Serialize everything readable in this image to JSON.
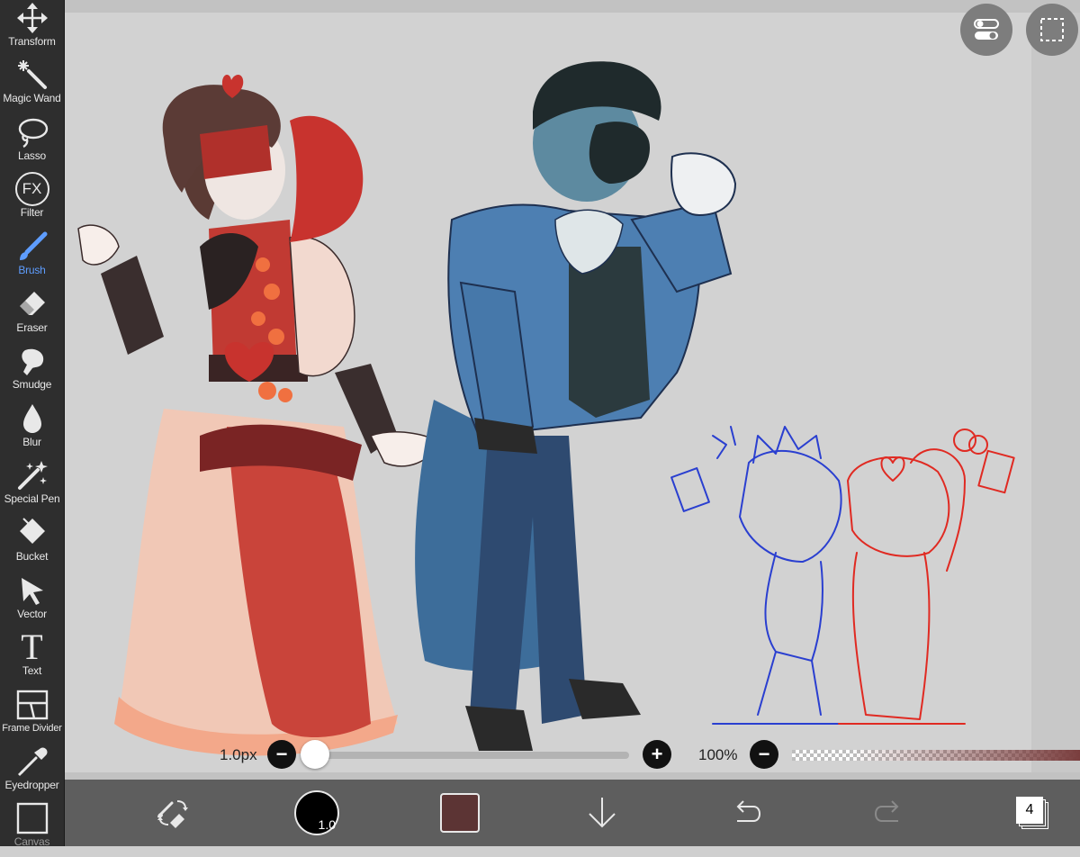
{
  "toolbar": {
    "tools": [
      {
        "label": "Transform"
      },
      {
        "label": "Magic Wand"
      },
      {
        "label": "Lasso"
      },
      {
        "label": "Filter",
        "icon_text": "FX"
      },
      {
        "label": "Brush"
      },
      {
        "label": "Eraser"
      },
      {
        "label": "Smudge"
      },
      {
        "label": "Blur"
      },
      {
        "label": "Special Pen"
      },
      {
        "label": "Bucket"
      },
      {
        "label": "Vector"
      },
      {
        "label": "Text",
        "icon_text": "T"
      },
      {
        "label": "Frame Divider"
      },
      {
        "label": "Eyedropper"
      },
      {
        "label": "Canvas"
      }
    ],
    "active_tool": "Brush",
    "active_color": "#5e9dff"
  },
  "brush_controls": {
    "size_label": "1.0px",
    "size_fraction": 0.0,
    "opacity_label": "100%",
    "opacity_fraction": 1.0
  },
  "bottom_bar": {
    "brush_size_badge": "1.0",
    "current_color": "#5c3434",
    "layer_count": "4"
  },
  "colors": {
    "toolbar_bg": "#2e2e2e",
    "bottom_bar_bg": "#5e5e5e",
    "canvas_bg": "#d2d2d2",
    "icon_fg": "#e8e8e8"
  }
}
